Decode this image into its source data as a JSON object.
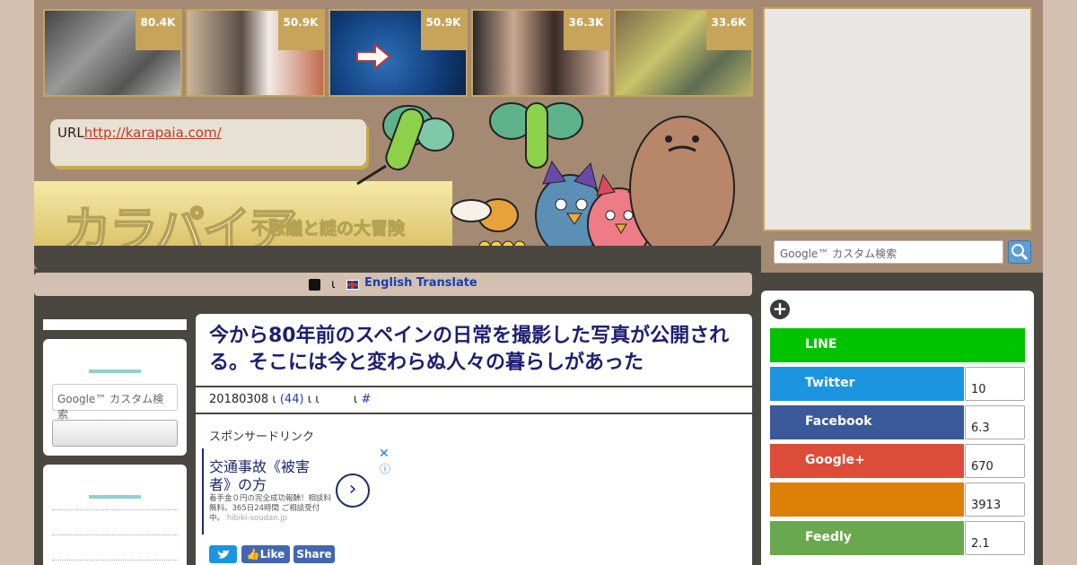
{
  "thumbnails": [
    {
      "count": "80.4K",
      "bg": "linear-gradient(135deg,#444,#999 40%,#555 70%,#bbb)"
    },
    {
      "count": "50.9K",
      "bg": "linear-gradient(90deg,#c9b59a,#5a4d45 40%,#f1ebe6 60%,#c26b4e)"
    },
    {
      "count": "50.9K",
      "bg": "radial-gradient(circle at 40% 60%,#2f6fb7,#0f3c78 60%,#0a1f3d)"
    },
    {
      "count": "36.3K",
      "bg": "linear-gradient(90deg,#2a2a2a,#caa890 30%,#3a2b26 60%,#d8b7a4)"
    },
    {
      "count": "33.6K",
      "bg": "linear-gradient(135deg,#7a6a4a,#c9c36a 40%,#5d6b52 70%,#b8b46a)"
    }
  ],
  "header": {
    "url_label": "URL",
    "url_link": "http://karapaia.com/",
    "logo": "カラパイア",
    "tagline": "不思議と謎の大冒険"
  },
  "translate": {
    "sep": "ι",
    "link": "English Translate"
  },
  "search": {
    "placeholder": "Google™ カスタム検索",
    "side_placeholder": "Google™ カスタム検索"
  },
  "article": {
    "title": "今から80年前のスペインの日常を撮影した写真が公開される。そこには今と変わらぬ人々の暮らしがあった",
    "meta_date": "20180308",
    "meta_sep1": "ι",
    "meta_comments": "(44)",
    "meta_sep2": "ι ι",
    "meta_sep3": "ι",
    "meta_hash": "#",
    "sponsor": "スポンサードリンク"
  },
  "ad": {
    "headline": "交通事故《被害者》の方",
    "body": "着手金０円の完全成功報酬！相談料無料。365日24時間 ご相談受付中。",
    "domain": "hibiki-soudan.jp",
    "close": "✕",
    "info": "ⓘ",
    "arrow": "›"
  },
  "share_buttons": {
    "like": "Like",
    "share": "Share"
  },
  "share_panel": [
    {
      "label": "LINE",
      "count": "",
      "color": "#00c300"
    },
    {
      "label": "Twitter",
      "count": "10",
      "color": "#1b95e0"
    },
    {
      "label": "Facebook",
      "count": "6.3",
      "color": "#3b5998"
    },
    {
      "label": "Google+",
      "count": "670",
      "color": "#dd4b39"
    },
    {
      "label": "",
      "count": "3913",
      "color": "#dc8007"
    },
    {
      "label": "Feedly",
      "count": "2.1",
      "color": "#6cc655"
    }
  ]
}
